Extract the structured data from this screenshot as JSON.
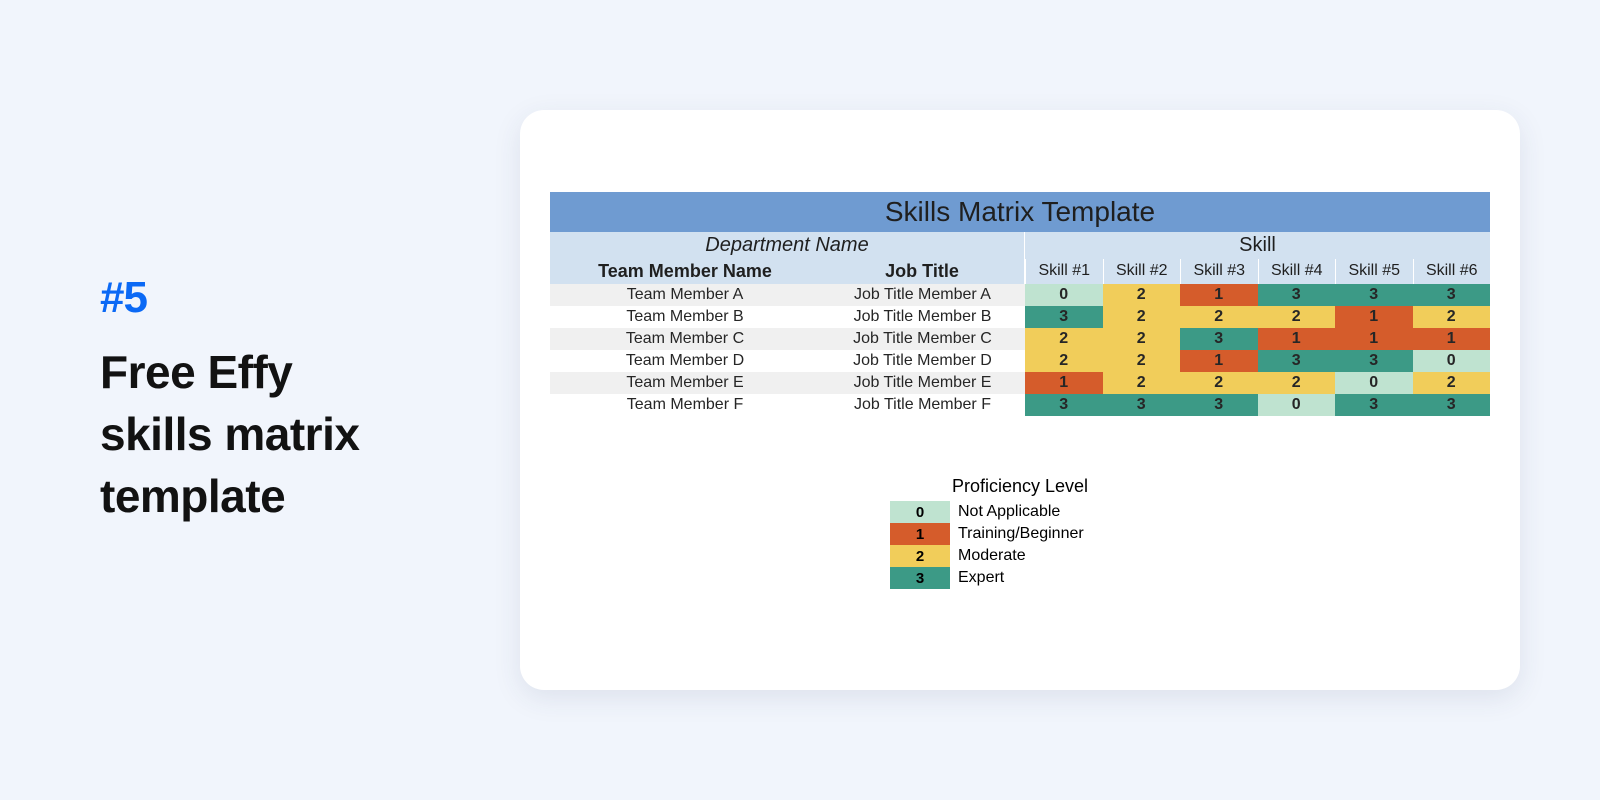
{
  "left": {
    "number": "#5",
    "title_line1": "Free Effy",
    "title_line2": "skills matrix",
    "title_line3": "template"
  },
  "matrix": {
    "title": "Skills Matrix Template",
    "dept_label": "Department Name",
    "skill_label": "Skill",
    "col_member": "Team Member Name",
    "col_job": "Job Title",
    "skill_cols": [
      "Skill #1",
      "Skill #2",
      "Skill #3",
      "Skill #4",
      "Skill #5",
      "Skill #6"
    ],
    "rows": [
      {
        "name": "Team Member A",
        "job": "Job Title Member A",
        "scores": [
          0,
          2,
          1,
          3,
          3,
          3
        ]
      },
      {
        "name": "Team Member B",
        "job": "Job Title Member B",
        "scores": [
          3,
          2,
          2,
          2,
          1,
          2
        ]
      },
      {
        "name": "Team Member C",
        "job": "Job Title Member C",
        "scores": [
          2,
          2,
          3,
          1,
          1,
          1
        ]
      },
      {
        "name": "Team Member D",
        "job": "Job Title Member D",
        "scores": [
          2,
          2,
          1,
          3,
          3,
          0
        ]
      },
      {
        "name": "Team Member E",
        "job": "Job Title Member E",
        "scores": [
          1,
          2,
          2,
          2,
          0,
          2
        ]
      },
      {
        "name": "Team Member F",
        "job": "Job Title Member F",
        "scores": [
          3,
          3,
          3,
          0,
          3,
          3
        ]
      }
    ]
  },
  "legend": {
    "title": "Proficiency Level",
    "items": [
      {
        "level": 0,
        "label": "Not Applicable"
      },
      {
        "level": 1,
        "label": "Training/Beginner"
      },
      {
        "level": 2,
        "label": "Moderate"
      },
      {
        "level": 3,
        "label": "Expert"
      }
    ]
  },
  "colors": {
    "0": "#bfe3d0",
    "1": "#d55c2b",
    "2": "#f1cd5a",
    "3": "#3c9a86"
  },
  "chart_data": {
    "type": "table",
    "title": "Skills Matrix Template",
    "categories": [
      "Skill #1",
      "Skill #2",
      "Skill #3",
      "Skill #4",
      "Skill #5",
      "Skill #6"
    ],
    "series": [
      {
        "name": "Team Member A",
        "values": [
          0,
          2,
          1,
          3,
          3,
          3
        ]
      },
      {
        "name": "Team Member B",
        "values": [
          3,
          2,
          2,
          2,
          1,
          2
        ]
      },
      {
        "name": "Team Member C",
        "values": [
          2,
          2,
          3,
          1,
          1,
          1
        ]
      },
      {
        "name": "Team Member D",
        "values": [
          2,
          2,
          1,
          3,
          3,
          0
        ]
      },
      {
        "name": "Team Member E",
        "values": [
          1,
          2,
          2,
          2,
          0,
          2
        ]
      },
      {
        "name": "Team Member F",
        "values": [
          3,
          3,
          3,
          0,
          3,
          3
        ]
      }
    ],
    "scale": {
      "0": "Not Applicable",
      "1": "Training/Beginner",
      "2": "Moderate",
      "3": "Expert"
    }
  }
}
